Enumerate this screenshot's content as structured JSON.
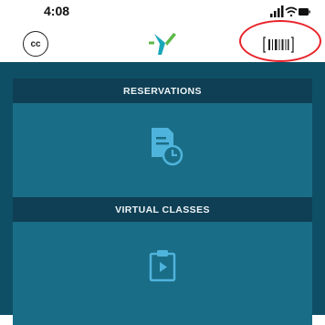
{
  "status_bar": {
    "time": "4:08",
    "icons": [
      "signal-icon",
      "wifi-icon",
      "battery-icon"
    ]
  },
  "nav_bar": {
    "cc_label": "cc",
    "logo": "ymca-y-logo",
    "barcode_icon": "barcode-icon"
  },
  "tiles": [
    {
      "label": "RESERVATIONS",
      "icon": "reservation-clock-icon"
    },
    {
      "label": "VIRTUAL CLASSES",
      "icon": "video-clipboard-icon"
    }
  ],
  "colors": {
    "background": "#0f4f66",
    "tile": "#1a6d86",
    "tile_header": "#0f3f54",
    "icon": "#4fb4dc",
    "highlight": "#e8232a",
    "logo_teal": "#1aa8b8",
    "logo_green": "#5cb848"
  }
}
